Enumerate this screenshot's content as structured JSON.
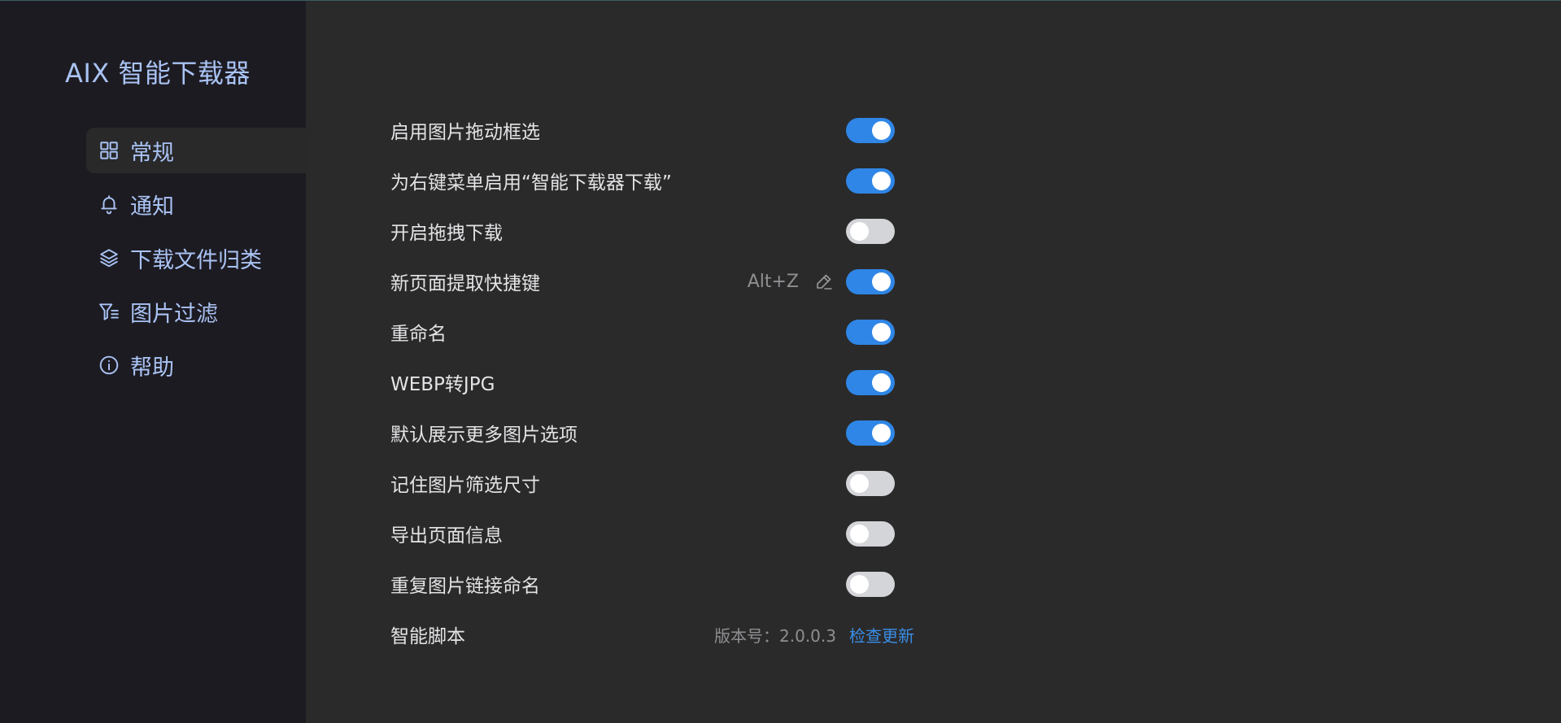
{
  "app": {
    "title": "AIX 智能下载器"
  },
  "sidebar": {
    "items": [
      {
        "label": "常规",
        "icon": "grid-icon",
        "active": true
      },
      {
        "label": "通知",
        "icon": "bell-icon",
        "active": false
      },
      {
        "label": "下载文件归类",
        "icon": "layers-icon",
        "active": false
      },
      {
        "label": "图片过滤",
        "icon": "filter-icon",
        "active": false
      },
      {
        "label": "帮助",
        "icon": "info-icon",
        "active": false
      }
    ]
  },
  "settings": {
    "rows": [
      {
        "label": "启用图片拖动框选",
        "enabled": true
      },
      {
        "label": "为右键菜单启用“智能下载器下载”",
        "enabled": true
      },
      {
        "label": "开启拖拽下载",
        "enabled": false
      },
      {
        "label": "新页面提取快捷键",
        "enabled": true,
        "shortcut": "Alt+Z"
      },
      {
        "label": "重命名",
        "enabled": true
      },
      {
        "label": "WEBP转JPG",
        "enabled": true
      },
      {
        "label": "默认展示更多图片选项",
        "enabled": true
      },
      {
        "label": "记住图片筛选尺寸",
        "enabled": false
      },
      {
        "label": "导出页面信息",
        "enabled": false
      },
      {
        "label": "重复图片链接命名",
        "enabled": false
      }
    ],
    "script": {
      "label": "智能脚本",
      "version": "版本号：2.0.0.3",
      "check_update": "检查更新"
    }
  },
  "colors": {
    "sidebar_bg": "#1d1b22",
    "main_bg": "#2a2a2b",
    "accent": "#2f86e6",
    "nav_text": "#a9c3f4",
    "link": "#3a8ee6"
  }
}
